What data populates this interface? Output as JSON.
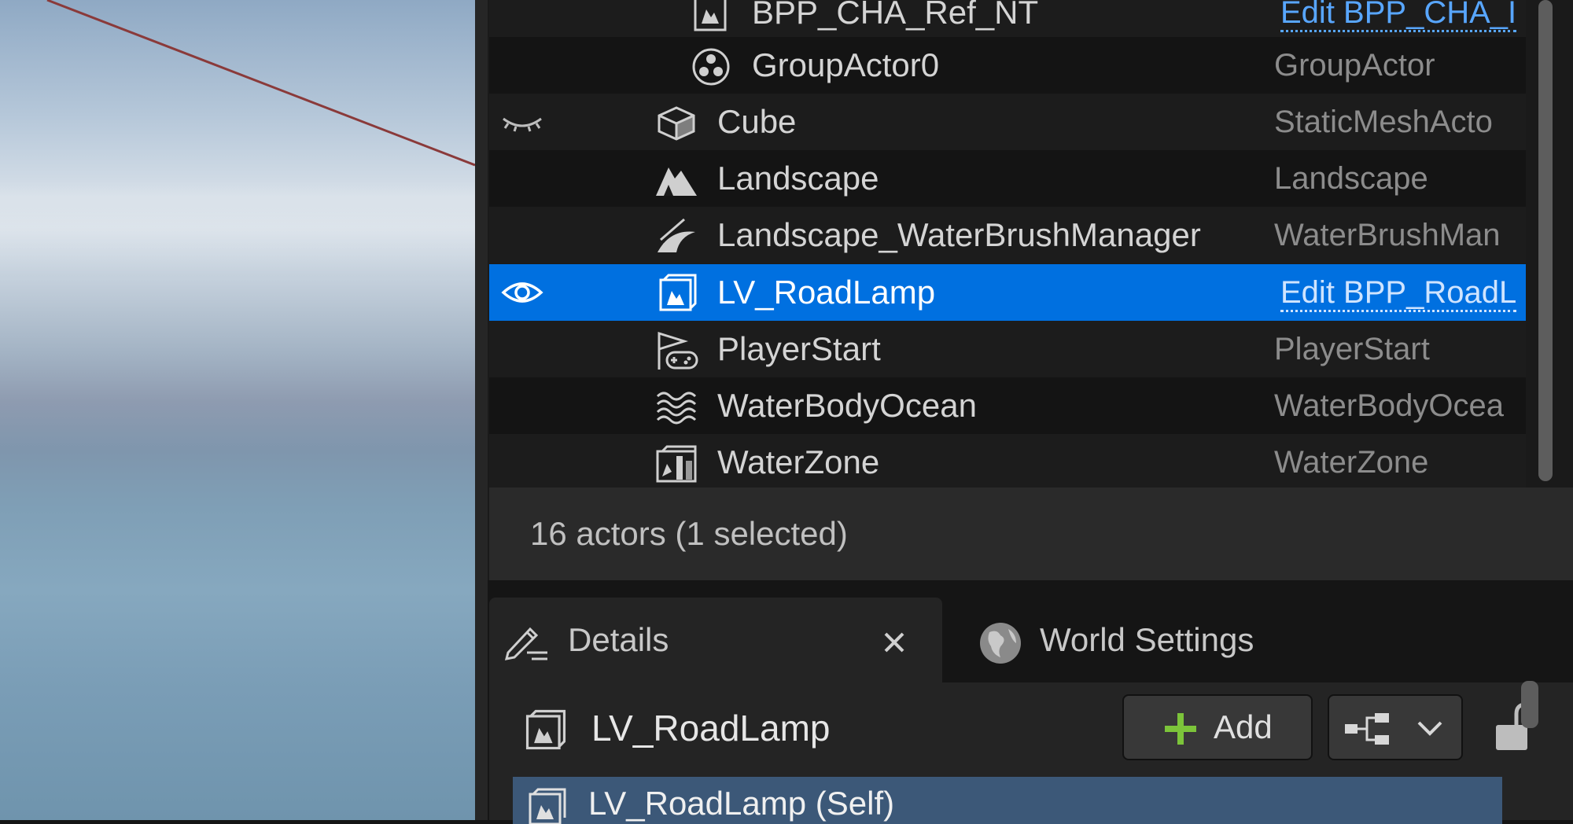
{
  "outliner": {
    "rows": [
      {
        "label": "BPP_CHA_Ref_NT",
        "type": "Edit BPP_CHA_I",
        "icon": "blueprint-actor-icon"
      },
      {
        "label": "GroupActor0",
        "type": "GroupActor",
        "icon": "group-actor-icon"
      },
      {
        "label": "Cube",
        "type": "StaticMeshActo",
        "icon": "static-mesh-icon",
        "visibility": "hidden"
      },
      {
        "label": "Landscape",
        "type": "Landscape",
        "icon": "landscape-icon"
      },
      {
        "label": "Landscape_WaterBrushManager",
        "type": "WaterBrushMan",
        "icon": "water-brush-icon"
      },
      {
        "label": "LV_RoadLamp",
        "type": "Edit BPP_RoadL",
        "icon": "blueprint-actor-icon",
        "selected": true,
        "visibility": "visible"
      },
      {
        "label": "PlayerStart",
        "type": "PlayerStart",
        "icon": "player-start-icon"
      },
      {
        "label": "WaterBodyOcean",
        "type": "WaterBodyOcea",
        "icon": "water-body-icon"
      },
      {
        "label": "WaterZone",
        "type": "WaterZone",
        "icon": "water-zone-icon"
      }
    ],
    "status": "16 actors (1 selected)"
  },
  "details": {
    "tabs": [
      {
        "label": "Details",
        "active": true
      },
      {
        "label": "World Settings",
        "active": false
      }
    ],
    "actor_name": "LV_RoadLamp",
    "add_label": "Add",
    "component_self": "LV_RoadLamp (Self)"
  },
  "colors": {
    "selection": "#0070e0",
    "link": "#58a6ff",
    "add_plus": "#7cc43a"
  }
}
